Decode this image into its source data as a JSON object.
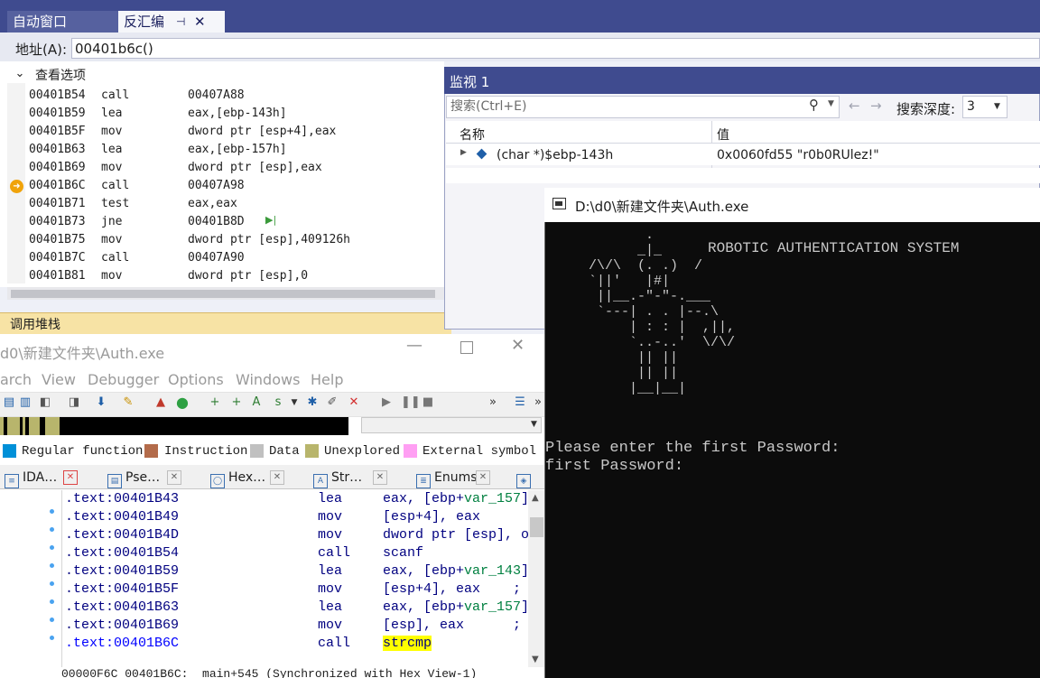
{
  "vs": {
    "tabs": {
      "auto": "自动窗口",
      "disasm": "反汇编",
      "pin": "⊣",
      "close": "✕"
    },
    "address_label": "地址(A):",
    "address_value": "00401b6c()",
    "view_options": "查看选项",
    "disasm": [
      {
        "addr": "00401B54",
        "op": "call",
        "arg": "00407A88"
      },
      {
        "addr": "00401B59",
        "op": "lea",
        "arg": "eax,[ebp-143h]"
      },
      {
        "addr": "00401B5F",
        "op": "mov",
        "arg": "dword ptr [esp+4],eax"
      },
      {
        "addr": "00401B63",
        "op": "lea",
        "arg": "eax,[ebp-157h]"
      },
      {
        "addr": "00401B69",
        "op": "mov",
        "arg": "dword ptr [esp],eax"
      },
      {
        "addr": "00401B6C",
        "op": "call",
        "arg": "00407A98"
      },
      {
        "addr": "00401B71",
        "op": "test",
        "arg": "eax,eax"
      },
      {
        "addr": "00401B73",
        "op": "jne",
        "arg": "00401B8D"
      },
      {
        "addr": "00401B75",
        "op": "mov",
        "arg": "dword ptr [esp],409126h"
      },
      {
        "addr": "00401B7C",
        "op": "call",
        "arg": "00407A90"
      },
      {
        "addr": "00401B81",
        "op": "mov",
        "arg": "dword ptr [esp],0"
      }
    ],
    "callstack": "调用堆栈"
  },
  "watch": {
    "title": "监视 1",
    "search_placeholder": "搜索(Ctrl+E)",
    "depth_label": "搜索深度:",
    "depth_value": "3",
    "col_name": "名称",
    "col_value": "值",
    "rows": [
      {
        "name": "(char *)$ebp-143h",
        "value": "0x0060fd55 \"r0b0RUlez!\""
      }
    ]
  },
  "ida": {
    "title": "d0\\新建文件夹\\Auth.exe",
    "menu": [
      "arch",
      "View",
      "Debugger",
      "Options",
      "Windows",
      "Help"
    ],
    "legend": [
      {
        "label": "Regular function",
        "color": "#0090d8"
      },
      {
        "label": "Instruction",
        "color": "#b36b4a"
      },
      {
        "label": "Data",
        "color": "#c0c0c0"
      },
      {
        "label": "Unexplored",
        "color": "#b8b56c"
      },
      {
        "label": "External symbol",
        "color": "#ff9ff3"
      }
    ],
    "tabs": [
      "IDA…",
      "Pse…",
      "Hex…",
      "Str…",
      "Enums"
    ],
    "lines": [
      {
        "seg": ".text:00401B43",
        "op": "lea",
        "arg": "eax, [ebp+",
        "var": "var_157",
        "tail": "]"
      },
      {
        "seg": ".text:00401B49",
        "op": "mov",
        "arg": "[esp+4], eax",
        "var": "",
        "tail": ""
      },
      {
        "seg": ".text:00401B4D",
        "op": "mov",
        "arg": "dword ptr [esp], o",
        "var": "",
        "tail": ""
      },
      {
        "seg": ".text:00401B54",
        "op": "call",
        "arg": "scanf",
        "var": "",
        "tail": ""
      },
      {
        "seg": ".text:00401B59",
        "op": "lea",
        "arg": "eax, [ebp+",
        "var": "var_143",
        "tail": "]"
      },
      {
        "seg": ".text:00401B5F",
        "op": "mov",
        "arg": "[esp+4], eax",
        "var": "",
        "tail": "    ;"
      },
      {
        "seg": ".text:00401B63",
        "op": "lea",
        "arg": "eax, [ebp+",
        "var": "var_157",
        "tail": "]"
      },
      {
        "seg": ".text:00401B69",
        "op": "mov",
        "arg": "[esp], eax",
        "var": "",
        "tail": "      ;"
      },
      {
        "seg": ".text:00401B6C",
        "op": "call",
        "arg": "strcmp",
        "var": "",
        "tail": ""
      }
    ],
    "status": "00000F6C 00401B6C: _main+545 (Synchronized with Hex View-1)"
  },
  "console": {
    "title": "D:\\d0\\新建文件夹\\Auth.exe",
    "banner": "ROBOTIC AUTHENTICATION SYSTEM",
    "robot": "        .\n       _|_\n /\\/\\  (. .)  /\n `||'   |#|\n  ||__.-\"-\"-.___\n  `---| . . |--.\\\n      | : : |  ,||,\n      `..-..'  \\/\\/\n       || ||\n       || ||\n      |__|__|",
    "prompt1": "Please enter the first Password:",
    "prompt2": "first Password:"
  }
}
